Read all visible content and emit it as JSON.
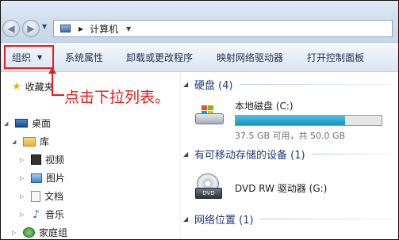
{
  "address": {
    "path": "计算机"
  },
  "toolbar": {
    "organize": "组织",
    "system_properties": "系统属性",
    "uninstall": "卸载或更改程序",
    "map_drive": "映射网络驱动器",
    "control_panel": "打开控制面板"
  },
  "nav": {
    "favorites": "收藏夹",
    "desktop": "桌面",
    "libraries": "库",
    "videos": "视频",
    "pictures": "图片",
    "documents": "文档",
    "music": "音乐",
    "homegroup": "家庭组"
  },
  "annotation": "点击下拉列表。",
  "content": {
    "hdd_group": "硬盘 (4)",
    "local_disk": "本地磁盘 (C:)",
    "local_disk_space": "37.5 GB 可用，共 50.0 GB",
    "local_disk_free_fraction": 0.75,
    "removable_group": "有可移动存储的设备 (1)",
    "dvd_drive": "DVD RW 驱动器 (G:)",
    "dvd_label": "DVD",
    "network_group": "网络位置 (1)"
  },
  "colors": {
    "highlight_red": "#e02020",
    "annotation_red": "#e21b1b",
    "group_header": "#1e3a78",
    "progress_fill": "#1a93c3"
  }
}
